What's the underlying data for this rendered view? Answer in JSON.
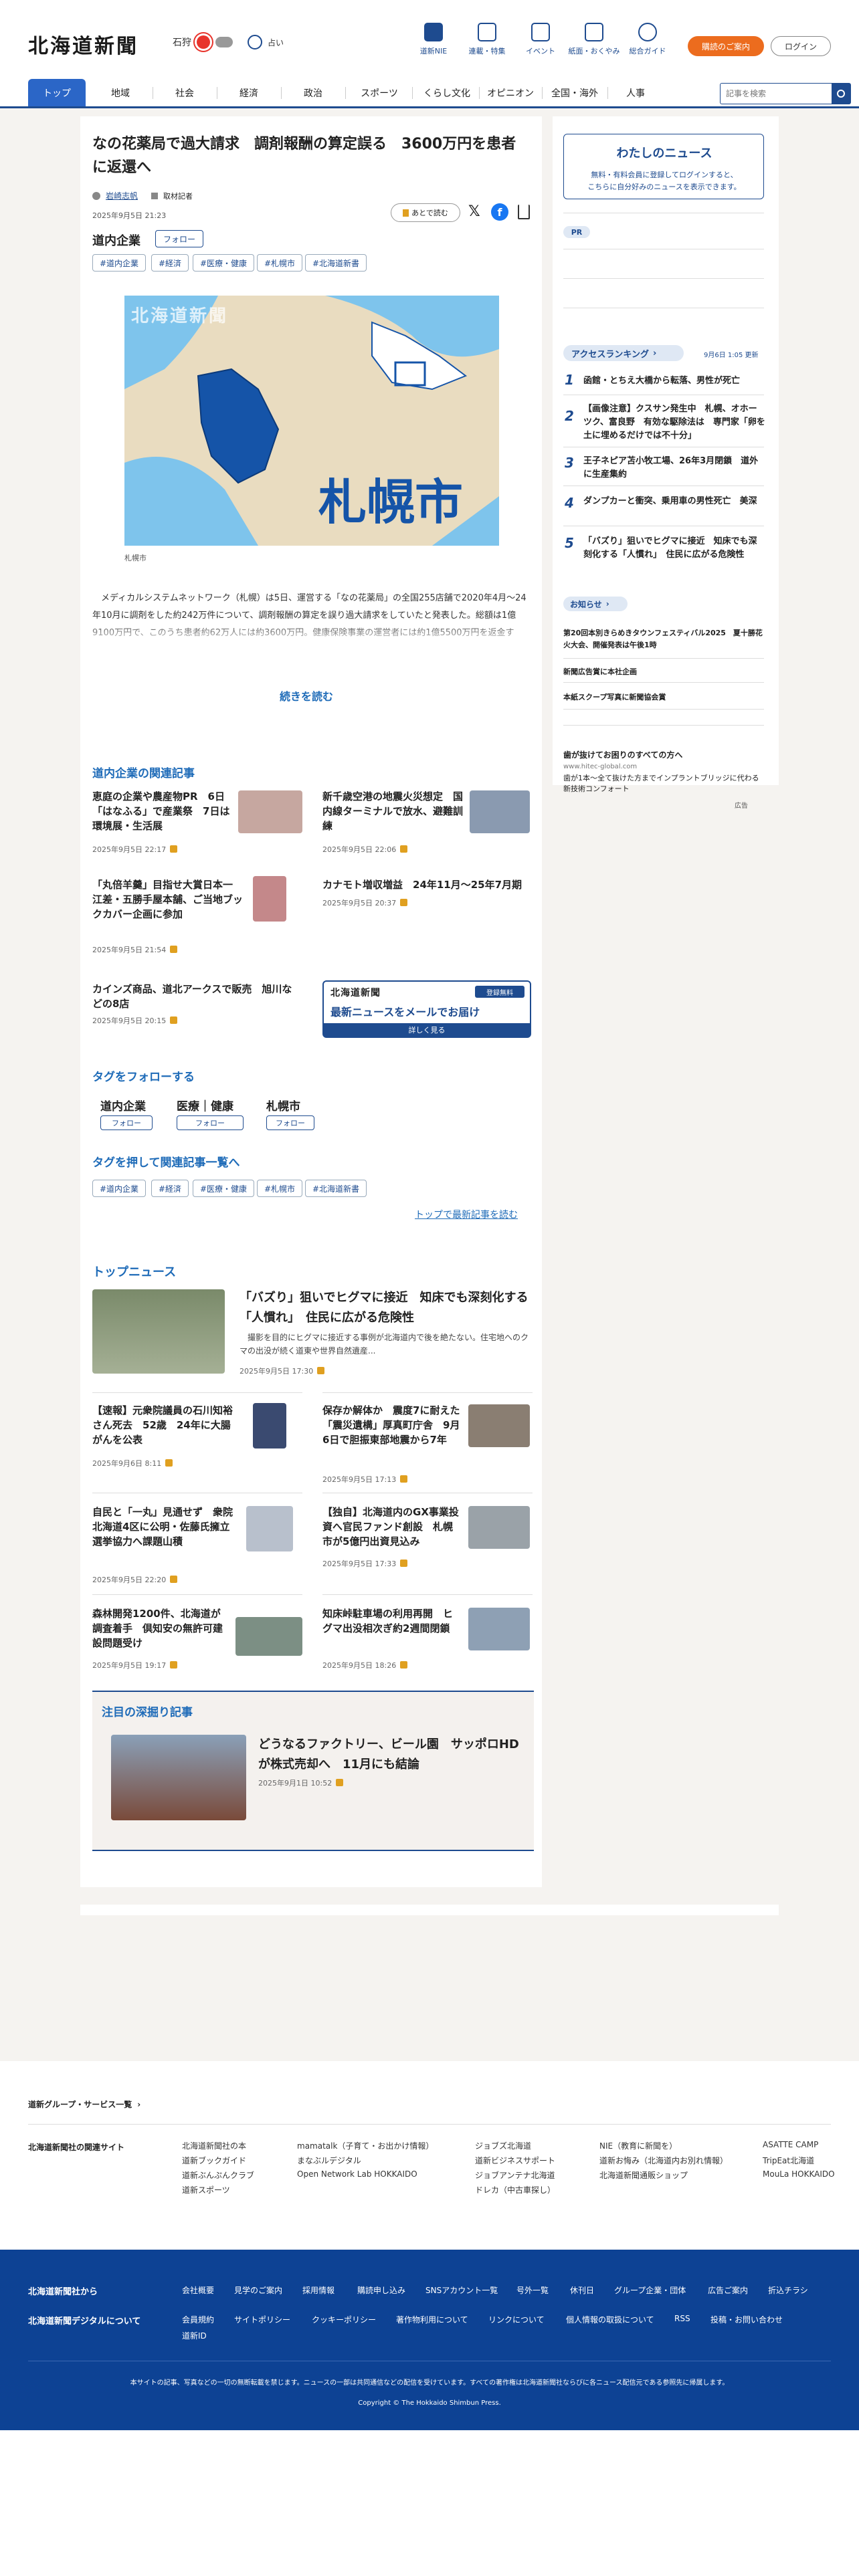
{
  "header": {
    "logo": "北海道新聞",
    "weather_city": "石狩",
    "weather_fortune": "占い",
    "util_nav": [
      "道新NIE",
      "連載・特集",
      "イベント",
      "紙面・おくやみ",
      "総合ガイド"
    ],
    "subscribe_button": "購読のご案内",
    "login_button": "ログイン"
  },
  "categories": [
    "トップ",
    "地域",
    "社会",
    "経済",
    "政治",
    "スポーツ",
    "くらし文化",
    "オピニオン",
    "全国・海外",
    "人事"
  ],
  "search": {
    "placeholder": "記事を検索"
  },
  "article": {
    "title": "なの花薬局で過大請求　調剤報酬の算定誤る　3600万円を患者に返還へ",
    "author": "岩崎志帆",
    "author_tag": "取材記者",
    "date": "2025年9月5日 21:23",
    "save_label": "あとで読む",
    "section": "道内企業",
    "follow_label": "フォロー",
    "tags": [
      "#道内企業",
      "#経済",
      "#医療・健康",
      "#札幌市",
      "#北海道新書"
    ],
    "map_watermark": "北海道新聞",
    "map_city": "札幌市",
    "caption": "札幌市",
    "body": "メディカルシステムネットワーク（札幌）は5日、運営する「なの花薬局」の全国255店舗で2020年4月〜24年10月に調剤をした約242万件について、調剤報酬の算定を誤り過大請求をしていたと発表した。総額は1億9100万円で、このうち患者約62万人には約3600万円。健康保険事業の運営者には約1億5500万円を返金する。...",
    "read_more": "続きを読む"
  },
  "related": {
    "heading": "道内企業の関連記事",
    "items": [
      {
        "title": "恵庭の企業や農産物PR　6日「はなふる」で産業祭　7日は環境展・生活展",
        "date": "2025年9月5日 22:17"
      },
      {
        "title": "新千歳空港の地震火災想定　国内線ターミナルで放水、避難訓練",
        "date": "2025年9月5日 22:06"
      },
      {
        "title": "「丸倍羊羹」目指せ大賞日本一　江差・五勝手屋本舗、ご当地ブックカバー企画に参加",
        "date": "2025年9月5日 21:54"
      },
      {
        "title": "カナモト増収増益　24年11月〜25年7月期",
        "date": "2025年9月5日 20:37"
      },
      {
        "title": "カインズ商品、道北アークスで販売　旭川などの8店",
        "date": "2025年9月5日 20:15"
      }
    ],
    "ad_logo": "北海道新聞",
    "ad_badge": "登録無料",
    "ad_title": "最新ニュースをメールでお届け",
    "ad_button": "詳しく見る"
  },
  "follow_tags": {
    "heading": "タグをフォローする",
    "items": [
      "道内企業",
      "医療｜健康",
      "札幌市"
    ],
    "button": "フォロー"
  },
  "tag_list": {
    "heading": "タグを押して関連記事一覧へ",
    "items": [
      "#道内企業",
      "#経済",
      "#医療・健康",
      "#札幌市",
      "#北海道新書"
    ],
    "more_link": "トップで最新記事を読む"
  },
  "top_news": {
    "heading": "トップニュース",
    "lead": {
      "title": "「バズり」狙いでヒグマに接近　知床でも深刻化する「人慣れ」　住民に広がる危険性",
      "summary": "撮影を目的にヒグマに接近する事例が北海道内で後を絶たない。住宅地へのクマの出没が続く道東や世界自然遺産...",
      "date": "2025年9月5日 17:30"
    },
    "items": [
      {
        "title": "【速報】元衆院議員の石川知裕さん死去　52歳　24年に大腸がんを公表",
        "date": "2025年9月6日 8:11"
      },
      {
        "title": "保存か解体か　震度7に耐えた「震災遺構」厚真町庁舎　9月6日で胆振東部地震から7年",
        "date": "2025年9月5日 17:13"
      },
      {
        "title": "自民と「一丸」見通せず　衆院北海道4区に公明・佐藤氏擁立　選挙協力へ課題山積",
        "date": "2025年9月5日 22:20"
      },
      {
        "title": "【独自】北海道内のGX事業投資へ官民ファンド創設　札幌市が5億円出資見込み",
        "date": "2025年9月5日 17:33"
      },
      {
        "title": "森林開発1200件、北海道が調査着手　倶知安の無許可建設問題受け",
        "date": "2025年9月5日 19:17"
      },
      {
        "title": "知床峠駐車場の利用再開　ヒグマ出没相次ぎ約2週間閉鎖",
        "date": "2025年9月5日 18:26"
      }
    ]
  },
  "deep_dive": {
    "heading": "注目の深掘り記事",
    "title": "どうなるファクトリー、ビール園　サッポロHDが株式売却へ　11月にも結論",
    "date": "2025年9月1日 10:52"
  },
  "sidebar": {
    "my_news_title": "わたしのニュース",
    "my_news_text_1": "無料・有料会員に登録してログインすると、",
    "my_news_text_2": "こちらに自分好みのニュースを表示できます。",
    "pr_label": "PR",
    "ranking_title": "アクセスランキング",
    "ranking_updated": "9月6日 1:05 更新",
    "ranking": [
      {
        "rank": "1",
        "title": "函館・とちえ大橋から転落、男性が死亡"
      },
      {
        "rank": "2",
        "title": "【画像注意】クスサン発生中　札幌、オホーツク、富良野　有効な駆除法は　専門家「卵を土に埋めるだけでは不十分」"
      },
      {
        "rank": "3",
        "title": "王子ネピア苫小牧工場、26年3月閉鎖　道外に生産集約"
      },
      {
        "rank": "4",
        "title": "ダンプカーと衝突、乗用車の男性死亡　美深"
      },
      {
        "rank": "5",
        "title": "「バズり」狙いでヒグマに接近　知床でも深刻化する「人慣れ」　住民に広がる危険性"
      }
    ],
    "notice_title": "お知らせ",
    "notices": [
      "第20回本別きらめきタウンフェスティバル2025　夏十勝花火大会、開催発表は午後1時",
      "新聞広告賞に本社企画",
      "本紙スクープ写真に新聞協会賞"
    ],
    "ad_title": "歯が抜けてお困りのすべての方へ",
    "ad_domain": "www.hitec-global.com",
    "ad_text": "歯が1本〜全て抜けた方までインプラントブリッジに代わる新技術コンフォート",
    "ad_label": "広告"
  },
  "footer": {
    "group_heading": "道新グループ・サービス一覧",
    "related_sites_heading": "北海道新聞社の関連サイト",
    "sites": [
      [
        "北海道新聞社の本",
        "道新ブックガイド",
        "道新ぶんぷんクラブ",
        "道新スポーツ"
      ],
      [
        "mamatalk（子育て・お出かけ情報）",
        "まなぶルデジタル",
        "Open Network Lab HOKKAIDO"
      ],
      [
        "ジョブズ北海道",
        "道新ビジネスサポート",
        "ジョブアンテナ北海道",
        "ドレカ（中古車探し）"
      ],
      [
        "NIE（教育に新聞を）",
        "道新お悔み（北海道内お別れ情報）",
        "北海道新聞通販ショップ"
      ],
      [
        "ASATTE CAMP",
        "TripEat北海道",
        "MouLa HOKKAIDO"
      ]
    ],
    "company_heading": "北海道新聞社から",
    "company_links": [
      "会社概要",
      "見学のご案内",
      "採用情報",
      "購読申し込み",
      "SNSアカウント一覧",
      "号外一覧",
      "休刊日",
      "グループ企業・団体",
      "広告ご案内",
      "折込チラシ"
    ],
    "digital_heading": "北海道新聞デジタルについて",
    "digital_links": [
      "会員規約",
      "サイトポリシー",
      "クッキーポリシー",
      "著作物利用について",
      "リンクについて",
      "個人情報の取扱について",
      "RSS",
      "投稿・お問い合わせ",
      "道新ID"
    ],
    "disclaimer": "本サイトの記事、写真などの一切の無断転載を禁じます。ニュースの一部は共同通信などの配信を受けています。すべての著作権は北海道新聞社ならびに各ニュース配信元である参照先に帰属します。",
    "copyright": "Copyright © The Hokkaido Shimbun Press."
  },
  "colors": {
    "brand_blue": "#1e4b8f",
    "accent_orange": "#ec6c1e",
    "footer_blue": "#0d4294"
  }
}
